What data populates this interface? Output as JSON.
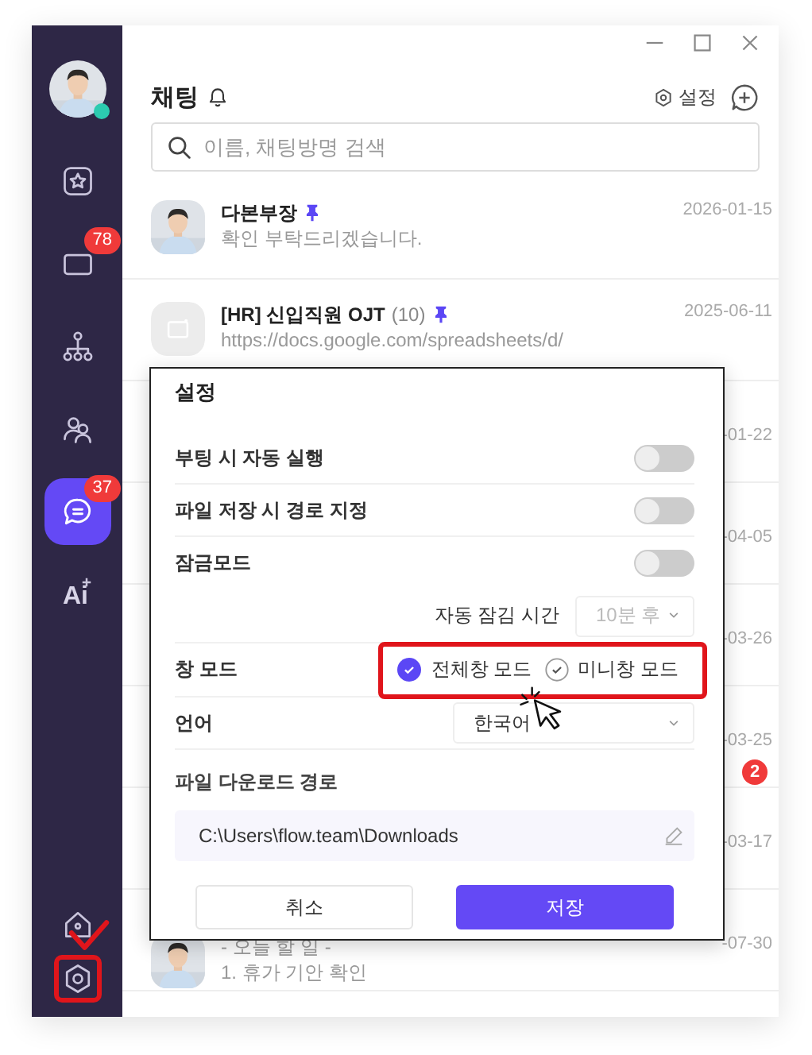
{
  "sidebar": {
    "items": [
      {
        "kind": "avatar",
        "online": true
      },
      {
        "kind": "star",
        "selected": false
      },
      {
        "kind": "box",
        "badge": "78",
        "selected": false
      },
      {
        "kind": "org",
        "selected": false
      },
      {
        "kind": "people",
        "selected": false
      },
      {
        "kind": "chat",
        "badge": "37",
        "selected": true
      },
      {
        "kind": "ai",
        "label": "Ai",
        "selected": false
      },
      {
        "kind": "home",
        "selected": false
      },
      {
        "kind": "settings",
        "selected": false
      }
    ]
  },
  "header": {
    "title": "채팅",
    "settings_label": "설정",
    "search": {
      "placeholder": "이름, 채팅방명 검색"
    }
  },
  "chats": [
    {
      "name": "다본부장",
      "pinned": true,
      "preview": [
        "확인 부탁드리겠습니다."
      ],
      "date": "2026-01-15"
    },
    {
      "kind": "group",
      "name": "[HR] 신입직원 OJT",
      "count": "(10)",
      "pinned": true,
      "preview": [
        "https://docs.google.com/spreadsheets/d/"
      ],
      "date": "2025-06-11"
    },
    {
      "date": "-01-22"
    },
    {
      "date": "-04-05"
    },
    {
      "date": "-03-26"
    },
    {
      "date": "-03-25",
      "unread": "2"
    },
    {
      "date": "-03-17"
    },
    {
      "preview": [
        "- 오늘 할 일 -",
        "1. 휴가 기안 확인"
      ],
      "date": "-07-30"
    }
  ],
  "dialog": {
    "title": "설정",
    "rows": [
      {
        "kind": "toggle",
        "label": "부팅 시 자동 실행",
        "on": false
      },
      {
        "kind": "toggle",
        "label": "파일 저장 시 경로 지정",
        "on": false
      },
      {
        "kind": "toggle",
        "label": "잠금모드",
        "on": false
      },
      {
        "kind": "select",
        "label": "자동 잠김 시간",
        "value": "10분 후",
        "disabled": true
      },
      {
        "kind": "radio",
        "label": "창 모드",
        "options": [
          {
            "label": "전체창 모드",
            "selected": true
          },
          {
            "label": "미니창 모드",
            "selected": false
          }
        ]
      },
      {
        "kind": "wideselect",
        "label": "언어",
        "value": "한국어",
        "disabled": false
      },
      {
        "kind": "path",
        "label": "파일 다운로드 경로",
        "value": "C:\\Users\\flow.team\\Downloads"
      }
    ],
    "buttons": [
      {
        "label": "취소",
        "primary": false
      },
      {
        "label": "저장",
        "primary": true
      }
    ]
  }
}
